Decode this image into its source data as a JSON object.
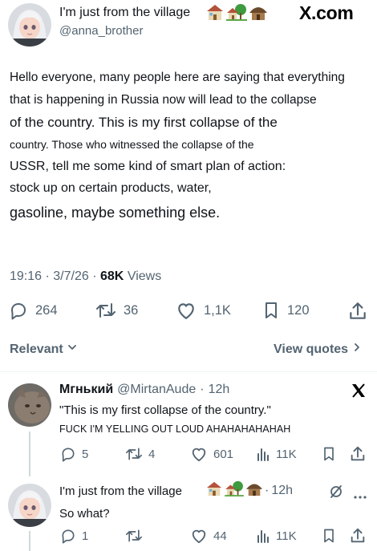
{
  "header": {
    "display_name": "I'm just from the village",
    "handle": "@anna_brother",
    "brand": "X.com",
    "emoji_icons": [
      "house-icon",
      "house-with-garden-icon",
      "hut-icon"
    ]
  },
  "post": {
    "lines": [
      "Hello everyone, many people here are saying that everything",
      "that is happening in Russia now will lead to the collapse",
      "of the country. This is my first collapse of the",
      "country. Those who witnessed the collapse of the",
      "USSR, tell me some kind of smart plan of action:",
      "stock up on certain products, water,",
      "gasoline, maybe something else."
    ],
    "time": "19:16",
    "date": "3/7/26",
    "views_count": "68K",
    "views_label": "Views",
    "separator": "·"
  },
  "stats": {
    "replies": "264",
    "reposts": "36",
    "likes": "1,1K",
    "bookmarks": "120"
  },
  "sort": {
    "relevant_label": "Relevant",
    "view_quotes_label": "View quotes"
  },
  "replies": [
    {
      "name": "Мгнький",
      "handle": "@MirtanAude",
      "time": "12h",
      "text": "\"This is my first collapse of the country.\"",
      "subtext": "FUCK I'M YELLING OUT LOUD AHAHAHAHAHAH",
      "replies": "5",
      "reposts": "4",
      "likes": "601",
      "views": "11K"
    },
    {
      "name": "I'm just from the village",
      "time": "12h",
      "text": "So what?",
      "replies": "1",
      "reposts": "",
      "likes": "44",
      "views": "11K"
    }
  ],
  "colors": {
    "text": "#0f1419",
    "secondary": "#536471",
    "divider": "#eff3f4"
  }
}
